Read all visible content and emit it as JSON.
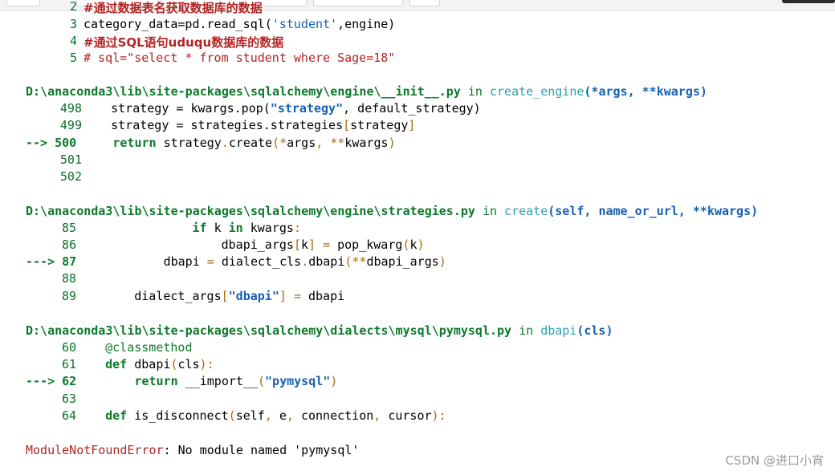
{
  "cell": {
    "lines": [
      {
        "n": "2",
        "text": "#通过数据表名获取数据库的数据"
      },
      {
        "n": "3",
        "pre": "category_data=pd.read_sql(",
        "str": "'student'",
        "post": ",engine)"
      },
      {
        "n": "4",
        "text": "#通过SQL语句uduqu数据库的数据"
      },
      {
        "n": "5",
        "text": "# sql=\"select * from student where Sage=18\""
      }
    ]
  },
  "frames": [
    {
      "path": "D:\\anaconda3\\lib\\site-packages\\sqlalchemy\\engine\\__init__.py",
      "in": "in",
      "func": "create_engine",
      "args": "(*args, **kwargs)",
      "lines": [
        {
          "marker": "",
          "n": "498",
          "code": "    strategy = kwargs.pop(\"strategy\", default_strategy)"
        },
        {
          "marker": "",
          "n": "499",
          "code": "    strategy = strategies.strategies[strategy]"
        },
        {
          "marker": "-->",
          "n": "500",
          "code": "    return strategy.create(*args, **kwargs)"
        },
        {
          "marker": "",
          "n": "501",
          "code": ""
        },
        {
          "marker": "",
          "n": "502",
          "code": ""
        }
      ]
    },
    {
      "path": "D:\\anaconda3\\lib\\site-packages\\sqlalchemy\\engine\\strategies.py",
      "in": "in",
      "func": "create",
      "args": "(self, name_or_url, **kwargs)",
      "lines": [
        {
          "marker": "",
          "n": "85",
          "code": "                if k in kwargs:"
        },
        {
          "marker": "",
          "n": "86",
          "code": "                    dbapi_args[k] = pop_kwarg(k)"
        },
        {
          "marker": "--->",
          "n": "87",
          "code": "            dbapi = dialect_cls.dbapi(**dbapi_args)"
        },
        {
          "marker": "",
          "n": "88",
          "code": ""
        },
        {
          "marker": "",
          "n": "89",
          "code": "        dialect_args[\"dbapi\"] = dbapi"
        }
      ]
    },
    {
      "path": "D:\\anaconda3\\lib\\site-packages\\sqlalchemy\\dialects\\mysql\\pymysql.py",
      "in": "in",
      "func": "dbapi",
      "args": "(cls)",
      "lines": [
        {
          "marker": "",
          "n": "60",
          "code": "    @classmethod"
        },
        {
          "marker": "",
          "n": "61",
          "code": "    def dbapi(cls):"
        },
        {
          "marker": "--->",
          "n": "62",
          "code": "        return __import__(\"pymysql\")"
        },
        {
          "marker": "",
          "n": "63",
          "code": ""
        },
        {
          "marker": "",
          "n": "64",
          "code": "    def is_disconnect(self, e, connection, cursor):"
        }
      ]
    }
  ],
  "error": {
    "type": "ModuleNotFoundError",
    "message": ": No module named 'pymysql'"
  },
  "watermark": "CSDN @进口小宵"
}
